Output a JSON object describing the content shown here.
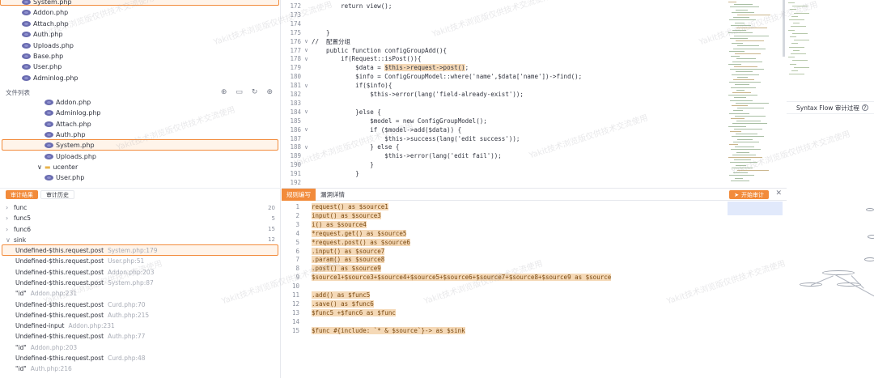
{
  "top_files": [
    "System.php",
    "Addon.php",
    "Attach.php",
    "Auth.php",
    "Uploads.php",
    "Base.php",
    "User.php",
    "Adminlog.php"
  ],
  "file_list": {
    "title": "文件列表",
    "items": [
      "Addon.php",
      "Adminlog.php",
      "Attach.php",
      "Auth.php",
      "System.php",
      "Uploads.php",
      "ucenter",
      "User.php"
    ]
  },
  "audit_tabs": {
    "active": "审计结果",
    "inactive": "审计历史"
  },
  "tree": [
    {
      "label": "func",
      "count": "20",
      "open": false
    },
    {
      "label": "func5",
      "count": "5",
      "open": false
    },
    {
      "label": "func6",
      "count": "15",
      "open": false
    },
    {
      "label": "sink",
      "count": "12",
      "open": true
    }
  ],
  "results": [
    {
      "name": "Undefined-$this.request.post",
      "loc": "System.php:179"
    },
    {
      "name": "Undefined-$this.request.post",
      "loc": "User.php:51"
    },
    {
      "name": "Undefined-$this.request.post",
      "loc": "Addon.php:203"
    },
    {
      "name": "Undefined-$this.request.post",
      "loc": "System.php:87"
    },
    {
      "name": "\"id\"",
      "loc": "Addon.php:231"
    },
    {
      "name": "Undefined-$this.request.post",
      "loc": "Curd.php:70"
    },
    {
      "name": "Undefined-$this.request.post",
      "loc": "Auth.php:215"
    },
    {
      "name": "Undefined-input",
      "loc": "Addon.php:231"
    },
    {
      "name": "Undefined-$this.request.post",
      "loc": "Auth.php:77"
    },
    {
      "name": "\"id\"",
      "loc": "Addon.php:203"
    },
    {
      "name": "Undefined-$this.request.post",
      "loc": "Curd.php:48"
    },
    {
      "name": "\"id\"",
      "loc": "Auth.php:216"
    }
  ],
  "code": [
    {
      "n": "172",
      "fold": "",
      "t": "        return view();"
    },
    {
      "n": "173",
      "fold": "",
      "t": ""
    },
    {
      "n": "174",
      "fold": "",
      "t": ""
    },
    {
      "n": "175",
      "fold": "",
      "t": "    }"
    },
    {
      "n": "176",
      "fold": "∨",
      "t": "//  配置分组"
    },
    {
      "n": "177",
      "fold": "∨",
      "t": "    public function configGroupAdd(){"
    },
    {
      "n": "178",
      "fold": "∨",
      "t": "        if(Request::isPost()){"
    },
    {
      "n": "179",
      "fold": "",
      "t": "            $data = $this->request->post();"
    },
    {
      "n": "180",
      "fold": "",
      "t": "            $info = ConfigGroupModel::where('name',$data['name'])->find();"
    },
    {
      "n": "181",
      "fold": "∨",
      "t": "            if($info){"
    },
    {
      "n": "182",
      "fold": "",
      "t": "                $this->error(lang('field-already-exist'));"
    },
    {
      "n": "183",
      "fold": "",
      "t": ""
    },
    {
      "n": "184",
      "fold": "∨",
      "t": "            }else {"
    },
    {
      "n": "185",
      "fold": "",
      "t": "                $model = new ConfigGroupModel();"
    },
    {
      "n": "186",
      "fold": "∨",
      "t": "                if ($model->add($data)) {"
    },
    {
      "n": "187",
      "fold": "",
      "t": "                    $this->success(lang('edit success'));"
    },
    {
      "n": "188",
      "fold": "∨",
      "t": "                } else {"
    },
    {
      "n": "189",
      "fold": "",
      "t": "                    $this->error(lang('edit fail'));"
    },
    {
      "n": "190",
      "fold": "",
      "t": "                }"
    },
    {
      "n": "191",
      "fold": "",
      "t": "            }"
    },
    {
      "n": "192",
      "fold": "",
      "t": ""
    }
  ],
  "rule_tabs": {
    "active": "规则编写",
    "inactive": "漏洞详情"
  },
  "start_audit": "开始审计",
  "rule_code": [
    {
      "n": "1",
      "t": "request() as $source1"
    },
    {
      "n": "2",
      "t": "input() as $source3"
    },
    {
      "n": "3",
      "t": "i() as $source4"
    },
    {
      "n": "4",
      "t": "*request.get() as $source5"
    },
    {
      "n": "5",
      "t": "*request.post() as $source6"
    },
    {
      "n": "6",
      "t": ".input() as $source7"
    },
    {
      "n": "7",
      "t": ".param() as $source8"
    },
    {
      "n": "8",
      "t": ".post() as $source9"
    },
    {
      "n": "9",
      "t": "$source1+$source3+$source4+$source5+$source6+$source7+$source8+$source9 as $source"
    },
    {
      "n": "10",
      "t": ""
    },
    {
      "n": "11",
      "t": ".add() as $func5"
    },
    {
      "n": "12",
      "t": ".save() as $func6"
    },
    {
      "n": "13",
      "t": "$func5 +$func6 as $func"
    },
    {
      "n": "14",
      "t": ""
    },
    {
      "n": "15",
      "t": "$func #{include: `* & $source`}-> as $sink"
    }
  ],
  "right_panel": {
    "title": "Syntax Flow 审计过程",
    "help_icon": "question-icon"
  },
  "watermark": "Yakit技术浏览版仅供技术交流使用",
  "colors": {
    "accent": "#f28b3b",
    "highlight": "#f5d9b7"
  }
}
